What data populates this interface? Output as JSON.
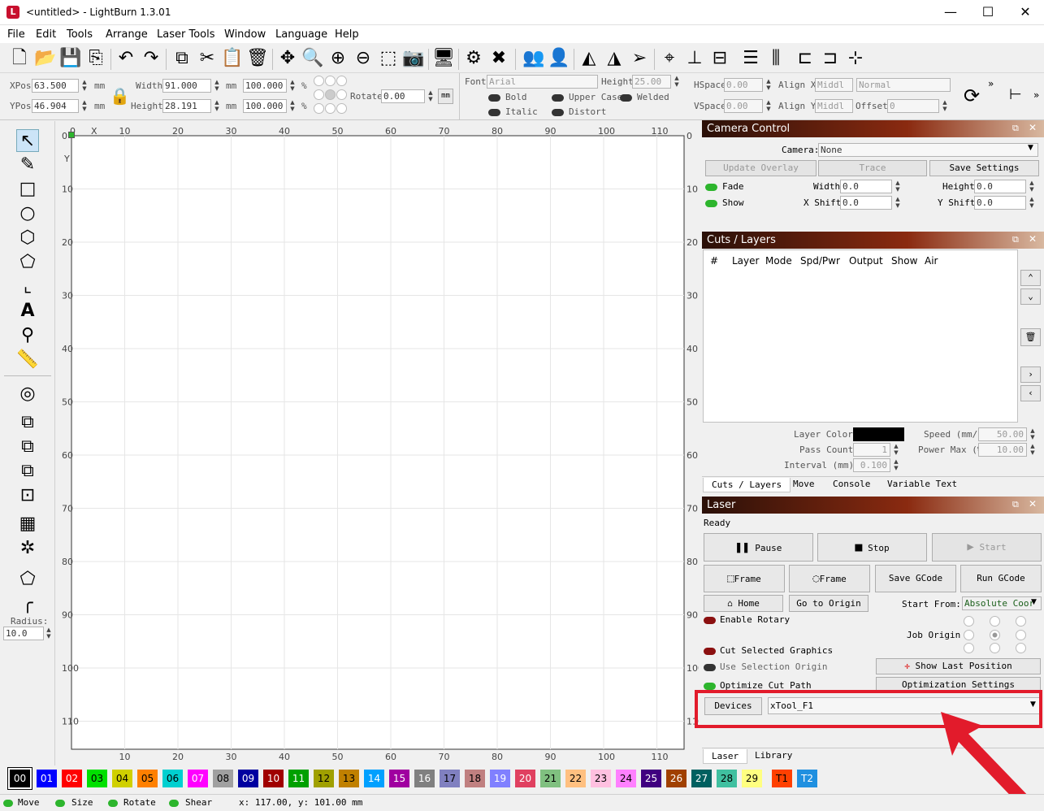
{
  "window": {
    "title": "<untitled> - LightBurn 1.3.01",
    "minimize": "—",
    "maximize": "☐",
    "close": "✕"
  },
  "menu": [
    "File",
    "Edit",
    "Tools",
    "Arrange",
    "Laser Tools",
    "Window",
    "Language",
    "Help"
  ],
  "props": {
    "xpos_label": "XPos",
    "xpos": "63.500",
    "ypos_label": "YPos",
    "ypos": "46.904",
    "mm": "mm",
    "width_label": "Width",
    "width": "91.000",
    "height_label": "Height",
    "height": "28.191",
    "pct_w": "100.000",
    "pct_h": "100.000",
    "pct": "%",
    "rotate_label": "Rotate",
    "rotate": "0.00",
    "unit_btn": "mm",
    "font_label": "Font",
    "font": "Arial",
    "fheight_label": "Height",
    "fheight": "25.00",
    "bold": "Bold",
    "italic": "Italic",
    "upper": "Upper Case",
    "welded": "Welded",
    "distort": "Distort",
    "hspace_label": "HSpace",
    "hspace": "0.00",
    "vspace_label": "VSpace",
    "vspace": "0.00",
    "alignx_label": "Align X",
    "alignx": "Middl",
    "aligny_label": "Align Y",
    "aligny": "Middl",
    "normal": "Normal",
    "offset_label": "Offset",
    "offset": "0"
  },
  "ruler": {
    "x": [
      "0",
      "10",
      "20",
      "30",
      "40",
      "50",
      "60",
      "70",
      "80",
      "90",
      "100",
      "110"
    ],
    "y": [
      "0",
      "10",
      "20",
      "30",
      "40",
      "50",
      "60",
      "70",
      "80",
      "90",
      "100",
      "110"
    ],
    "xlabel": "X",
    "ylabel": "Y"
  },
  "left": {
    "radius_label": "Radius:",
    "radius": "10.0"
  },
  "camera": {
    "title": "Camera Control",
    "camera_label": "Camera:",
    "camera": "None",
    "update": "Update Overlay",
    "trace": "Trace",
    "save": "Save Settings",
    "fade": "Fade",
    "show": "Show",
    "width_label": "Width",
    "width": "0.0",
    "height_label": "Height",
    "height": "0.0",
    "xshift_label": "X Shift",
    "xshift": "0.0",
    "yshift_label": "Y Shift",
    "yshift": "0.0"
  },
  "cuts": {
    "title": "Cuts / Layers",
    "cols": [
      "#",
      "Layer",
      "Mode",
      "Spd/Pwr",
      "Output",
      "Show",
      "Air"
    ],
    "layer_color": "Layer Color",
    "speed_label": "Speed (mm/s)",
    "speed": "50.00",
    "pass_label": "Pass Count",
    "pass": "1",
    "power_label": "Power Max (%)",
    "power": "10.00",
    "interval_label": "Interval (mm)",
    "interval": "0.100",
    "tabs": [
      "Cuts / Layers",
      "Move",
      "Console",
      "Variable Text"
    ]
  },
  "laser": {
    "title": "Laser",
    "status": "Ready",
    "pause": "Pause",
    "stop": "Stop",
    "start": "Start",
    "frame1": "Frame",
    "frame2": "Frame",
    "save_gcode": "Save GCode",
    "run_gcode": "Run GCode",
    "home": "Home",
    "goto_origin": "Go to Origin",
    "start_from_label": "Start From:",
    "start_from": "Absolute Coor",
    "enable_rotary": "Enable Rotary",
    "job_origin": "Job Origin",
    "cut_selected": "Cut Selected Graphics",
    "use_selection": "Use Selection Origin",
    "optimize": "Optimize Cut Path",
    "show_last": "Show Last Position",
    "opt_settings": "Optimization Settings",
    "devices": "Devices",
    "device": "xTool_F1",
    "tabs": [
      "Laser",
      "Library"
    ]
  },
  "palette": [
    {
      "n": "00",
      "c": "#000000",
      "t": "#ffffff"
    },
    {
      "n": "01",
      "c": "#0000ff",
      "t": "#ffffff"
    },
    {
      "n": "02",
      "c": "#ff0000",
      "t": "#ffffff"
    },
    {
      "n": "03",
      "c": "#00e000",
      "t": "#000000"
    },
    {
      "n": "04",
      "c": "#d0d000",
      "t": "#000000"
    },
    {
      "n": "05",
      "c": "#ff8000",
      "t": "#000000"
    },
    {
      "n": "06",
      "c": "#00d0d0",
      "t": "#000000"
    },
    {
      "n": "07",
      "c": "#ff00ff",
      "t": "#ffffff"
    },
    {
      "n": "08",
      "c": "#a0a0a0",
      "t": "#000000"
    },
    {
      "n": "09",
      "c": "#0000a0",
      "t": "#ffffff"
    },
    {
      "n": "10",
      "c": "#a00000",
      "t": "#ffffff"
    },
    {
      "n": "11",
      "c": "#00a000",
      "t": "#ffffff"
    },
    {
      "n": "12",
      "c": "#a0a000",
      "t": "#000000"
    },
    {
      "n": "13",
      "c": "#c08000",
      "t": "#000000"
    },
    {
      "n": "14",
      "c": "#00a0ff",
      "t": "#ffffff"
    },
    {
      "n": "15",
      "c": "#a000a0",
      "t": "#ffffff"
    },
    {
      "n": "16",
      "c": "#808080",
      "t": "#ffffff"
    },
    {
      "n": "17",
      "c": "#8080c0",
      "t": "#000000"
    },
    {
      "n": "18",
      "c": "#c08080",
      "t": "#000000"
    },
    {
      "n": "19",
      "c": "#8080ff",
      "t": "#ffffff"
    },
    {
      "n": "20",
      "c": "#e04060",
      "t": "#ffffff"
    },
    {
      "n": "21",
      "c": "#80c080",
      "t": "#000000"
    },
    {
      "n": "22",
      "c": "#ffc080",
      "t": "#000000"
    },
    {
      "n": "23",
      "c": "#ffc0e0",
      "t": "#000000"
    },
    {
      "n": "24",
      "c": "#ff80ff",
      "t": "#000000"
    },
    {
      "n": "25",
      "c": "#400080",
      "t": "#ffffff"
    },
    {
      "n": "26",
      "c": "#a04000",
      "t": "#ffffff"
    },
    {
      "n": "27",
      "c": "#006060",
      "t": "#ffffff"
    },
    {
      "n": "28",
      "c": "#40c0a0",
      "t": "#000000"
    },
    {
      "n": "29",
      "c": "#ffff80",
      "t": "#000000"
    },
    {
      "n": "T1",
      "c": "#ff4000",
      "t": "#000000"
    },
    {
      "n": "T2",
      "c": "#2090e0",
      "t": "#ffffff"
    }
  ],
  "status": {
    "move": "Move",
    "size": "Size",
    "rotate": "Rotate",
    "shear": "Shear",
    "coords": "x: 117.00, y: 101.00 mm"
  },
  "accent": {
    "highlight": "#e21b2b",
    "arrow": "#e21b2b"
  }
}
